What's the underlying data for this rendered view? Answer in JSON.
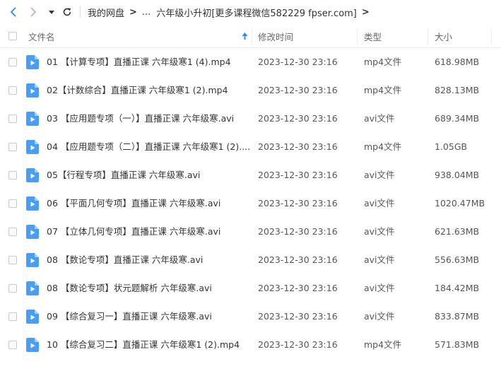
{
  "nav": {
    "back_icon": "chevron-left-icon",
    "forward_icon": "chevron-right-icon",
    "dropdown_icon": "caret-down-icon",
    "refresh_icon": "refresh-icon",
    "accent": "#2a8cf0"
  },
  "breadcrumb": {
    "root": "我的网盘",
    "ellipsis": "...",
    "current": "六年级小升初[更多课程微信582229 fpser.com]"
  },
  "header": {
    "name": "文件名",
    "sort_icon": "sort-asc-icon",
    "modified": "修改时间",
    "type": "类型",
    "size": "大小"
  },
  "files": [
    {
      "name": "01 【计算专项】直播正课 六年级寒1 (4).mp4",
      "modified": "2023-12-30 23:16",
      "type": "mp4文件",
      "size": "618.98MB"
    },
    {
      "name": "02【计数综合】直播正课 六年级寒1 (2).mp4",
      "modified": "2023-12-30 23:16",
      "type": "mp4文件",
      "size": "828.13MB"
    },
    {
      "name": "03 【应用题专项（一）】直播正课 六年级寒.avi",
      "modified": "2023-12-30 23:16",
      "type": "avi文件",
      "size": "689.34MB"
    },
    {
      "name": "04 【应用题专项（二）】直播正课 六年级寒1 (2)....",
      "modified": "2023-12-30 23:16",
      "type": "mp4文件",
      "size": "1.05GB"
    },
    {
      "name": "05【行程专项】直播正课 六年级寒.avi",
      "modified": "2023-12-30 23:16",
      "type": "avi文件",
      "size": "938.04MB"
    },
    {
      "name": "06 【平面几何专项】直播正课 六年级寒.avi",
      "modified": "2023-12-30 23:16",
      "type": "avi文件",
      "size": "1020.47MB"
    },
    {
      "name": "07 【立体几何专项】直播正课 六年级寒.avi",
      "modified": "2023-12-30 23:16",
      "type": "avi文件",
      "size": "621.63MB"
    },
    {
      "name": "08 【数论专项】直播正课 六年级寒.avi",
      "modified": "2023-12-30 23:16",
      "type": "avi文件",
      "size": "556.63MB"
    },
    {
      "name": "08 【数论专项】状元题解析 六年级寒.avi",
      "modified": "2023-12-30 23:16",
      "type": "avi文件",
      "size": "184.42MB"
    },
    {
      "name": "09 【综合复习一】直播正课 六年级寒.avi",
      "modified": "2023-12-30 23:16",
      "type": "avi文件",
      "size": "833.87MB"
    },
    {
      "name": "10 【综合复习二】直播正课 六年级寒1 (2).mp4",
      "modified": "2023-12-30 23:16",
      "type": "mp4文件",
      "size": "571.83MB"
    }
  ]
}
